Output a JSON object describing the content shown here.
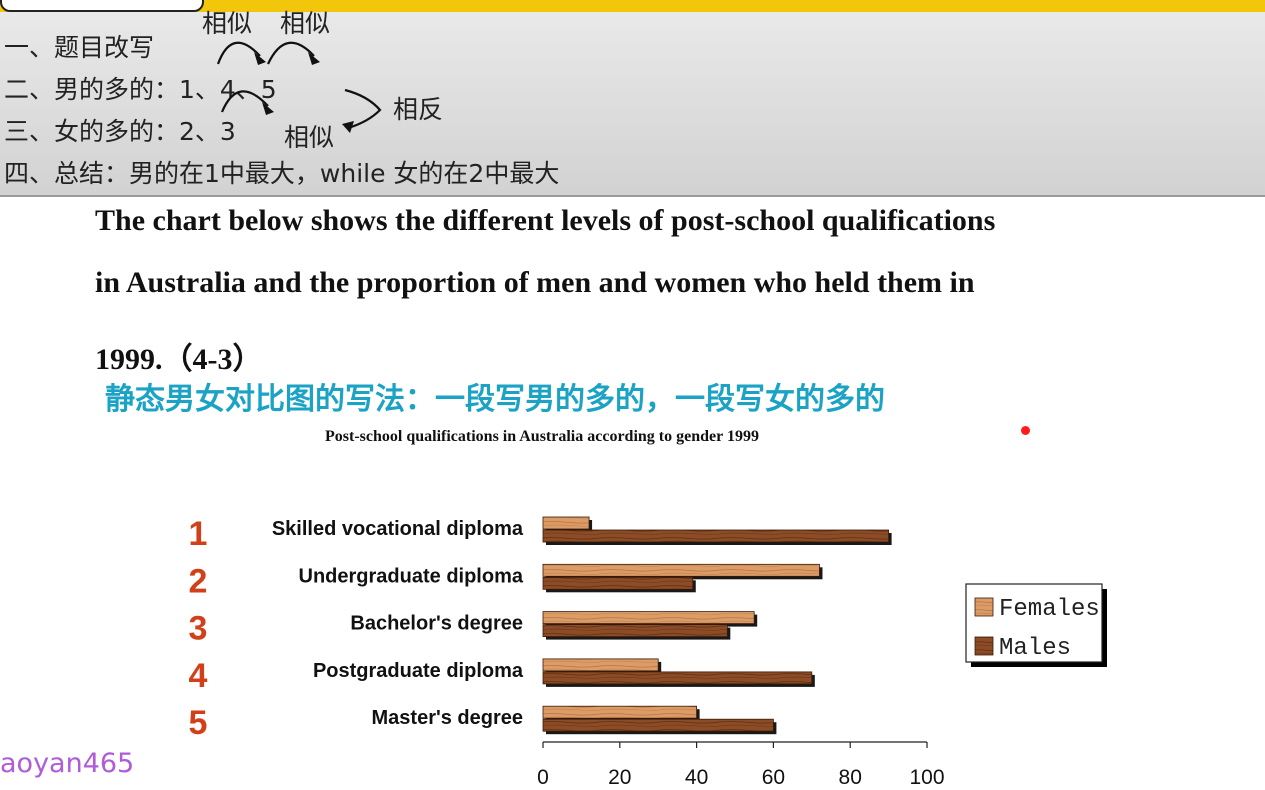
{
  "notes": {
    "lines": [
      "一、题目改写",
      "二、男的多的：1、4、5",
      "三、女的多的：2、3",
      "四、总结：男的在1中最大，while 女的在2中最大"
    ],
    "annotations": {
      "similar_1": "相似",
      "similar_2": "相似",
      "similar_3": "相似",
      "opposite": "相反"
    }
  },
  "question": {
    "line1": "The chart below shows the different levels of post-school qualifications",
    "line2": "in Australia and the proportion of men and women who held them in",
    "line3": "1999.（4-3）"
  },
  "subtitle": "静态男女对比图的写法：一段写男的多的，一段写女的多的",
  "watermark": "aoyan465",
  "colors": {
    "top_bar": "#f2c60a",
    "subtitle": "#1aa3c4",
    "number_labels": "#d2401a",
    "females": "#d99a67",
    "males": "#8a4a24",
    "watermark": "#b05bd8"
  },
  "chart_data": {
    "type": "bar",
    "orientation": "horizontal",
    "title": "Post-school qualifications in Australia according to gender 1999",
    "xlabel": "",
    "ylabel": "",
    "xlim": [
      0,
      100
    ],
    "x_ticks": [
      "0",
      "20",
      "40",
      "60",
      "80",
      "100"
    ],
    "categories": [
      "Skilled vocational diploma",
      "Undergraduate diploma",
      "Bachelor's degree",
      "Postgraduate diploma",
      "Master's degree"
    ],
    "category_numbers": [
      "1",
      "2",
      "3",
      "4",
      "5"
    ],
    "series": [
      {
        "name": "Females",
        "values": [
          12,
          72,
          55,
          30,
          40
        ]
      },
      {
        "name": "Males",
        "values": [
          90,
          39,
          48,
          70,
          60
        ]
      }
    ],
    "legend_position": "right",
    "grid": false
  }
}
